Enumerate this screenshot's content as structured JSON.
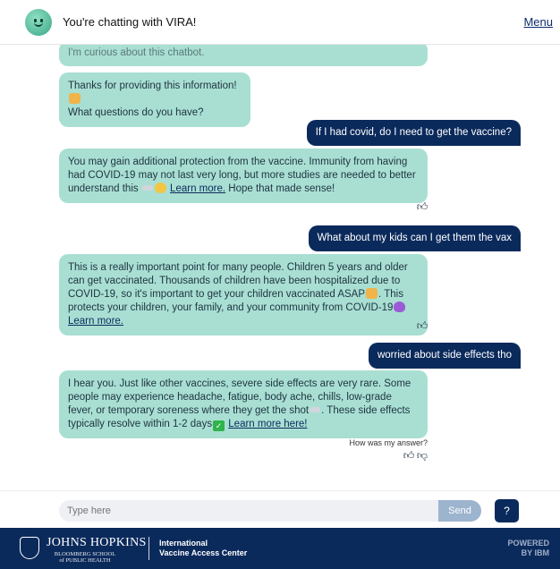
{
  "header": {
    "title": "You're chatting with VIRA!",
    "menu": "Menu"
  },
  "messages": {
    "m0": "I'm curious about this chatbot.",
    "m1_line1": "Thanks for providing this information!",
    "m1_line2": "What questions do you have?",
    "u1": "If I had covid, do I need to get the vaccine?",
    "m2_text": "You may gain additional protection from the vaccine. Immunity from having had COVID-19 may not last very long, but more studies are needed to better understand this",
    "m2_link": "Learn more.",
    "m2_tail": "Hope that made sense!",
    "u2": "What about my kids can I get them the vax",
    "m3_text": "This is a really important point for many people. Children 5 years and older can get vaccinated. Thousands of children have been hospitalized due to COVID-19, so it's important to get your children vaccinated ASAP",
    "m3_mid": ". This protects your children, your family, and your community from COVID-19",
    "m3_link": "Learn more.",
    "u3": "worried about side effects tho",
    "m4_text": "I hear you. Just like other vaccines, severe side effects are very rare. Some people may experience headache, fatigue, body ache, chills, low-grade fever, or temporary soreness where they get the shot",
    "m4_mid": ". These side effects typically resolve within 1-2 days",
    "m4_link": "Learn more here!",
    "feedback_prompt": "How was my answer?"
  },
  "input": {
    "placeholder": "Type here",
    "send": "Send",
    "help": "?"
  },
  "footer": {
    "org": "JOHNS HOPKINS",
    "org_sub1": "BLOOMBERG SCHOOL",
    "org_sub2": "of PUBLIC HEALTH",
    "center_line1": "International",
    "center_line2": "Vaccine Access Center",
    "powered_line1": "POWERED",
    "powered_line2": "BY IBM"
  },
  "icons": [
    "bot-avatar-icon",
    "thumbs-up-icon",
    "thumbs-down-icon",
    "shield-icon",
    "pray-emoji-icon",
    "heart-emoji-icon",
    "check-emoji-icon"
  ],
  "colors": {
    "bot_bubble": "#a9dfd3",
    "user_bubble": "#0b2a5c",
    "footer": "#0b2a5c",
    "send": "#9db4cf"
  }
}
